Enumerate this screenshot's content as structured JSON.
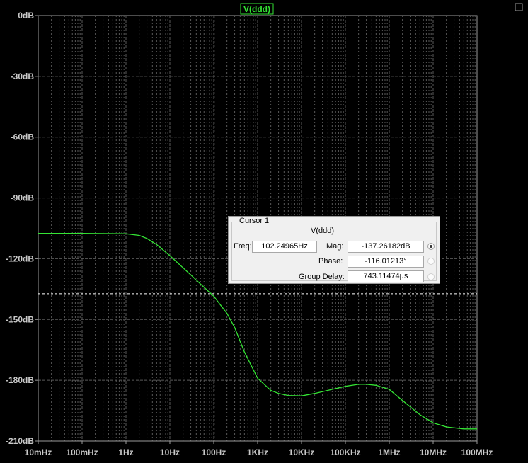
{
  "chart_data": {
    "type": "line",
    "trace_label": "V(ddd)",
    "x_scale": "log",
    "x_ticks": [
      "10mHz",
      "100mHz",
      "1Hz",
      "10Hz",
      "100Hz",
      "1KHz",
      "10KHz",
      "100KHz",
      "1MHz",
      "10MHz",
      "100MHz"
    ],
    "y_ticks": [
      "0dB",
      "-30dB",
      "-60dB",
      "-90dB",
      "-120dB",
      "-150dB",
      "-180dB",
      "-210dB"
    ],
    "xlim": [
      0.01,
      100000000
    ],
    "ylim": [
      -210,
      0
    ],
    "grid": true,
    "series": [
      {
        "name": "V(ddd)",
        "color": "#34e534",
        "x": [
          0.01,
          0.1,
          1,
          2,
          3,
          5,
          10,
          20,
          30,
          50,
          100,
          200,
          300,
          500,
          1000,
          2000,
          3000,
          5000,
          10000,
          20000,
          50000,
          100000,
          200000,
          300000,
          500000,
          1000000,
          2000000,
          5000000,
          10000000,
          20000000,
          50000000,
          100000000
        ],
        "y": [
          -107.5,
          -107.5,
          -107.7,
          -108.5,
          -110,
          -113,
          -118.5,
          -124.5,
          -128,
          -132.5,
          -138.5,
          -147,
          -154,
          -166,
          -179,
          -185,
          -186.5,
          -187.5,
          -187.7,
          -186.5,
          -184.5,
          -183,
          -182,
          -182,
          -182.5,
          -184.5,
          -190,
          -197,
          -201,
          -203,
          -204,
          -204
        ]
      }
    ],
    "colors": {
      "background": "#000000",
      "grid": "#5a5a5a",
      "trace": "#34e534",
      "cursor": "#ffffff"
    }
  },
  "cursor": {
    "x_value": 102.24965,
    "y_value": -137.26182,
    "title": "Cursor 1",
    "trace": "V(ddd)",
    "freq_label": "Freq:",
    "freq_value": "102.24965Hz",
    "mag_label": "Mag:",
    "mag_value": "-137.26182dB",
    "phase_label": "Phase:",
    "phase_value": "-116.01213°",
    "delay_label": "Group Delay:",
    "delay_value": "743.11474µs",
    "selected_field": "Mag"
  }
}
